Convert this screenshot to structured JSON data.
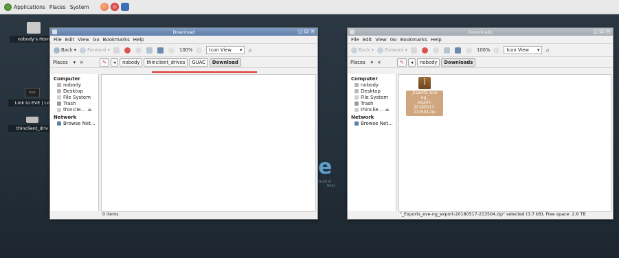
{
  "panel": {
    "menus": [
      "Applications",
      "Places",
      "System"
    ],
    "icons": [
      "applications-icon",
      "firefox-icon",
      "app-launcher-icon"
    ]
  },
  "desktop": {
    "icons": [
      {
        "label": "nobody's Hom",
        "icon": "home-folder-icon"
      },
      {
        "label": "Link to EVE | Lo",
        "icon": "eve-logo-icon"
      },
      {
        "label": "thinclient_driv",
        "icon": "drive-icon"
      }
    ],
    "watermark": "e",
    "watermark_sub_1": "ulated Vi",
    "watermark_sub_2": "Next"
  },
  "window_left": {
    "title": "Download",
    "menu": [
      "File",
      "Edit",
      "View",
      "Go",
      "Bookmarks",
      "Help"
    ],
    "toolbar": {
      "back": "Back",
      "forward": "Forward",
      "zoom": "100%",
      "view": "Icon View"
    },
    "places_label": "Places",
    "breadcrumbs": [
      "nobody",
      "thinclient_drives",
      "GUAC",
      "Download"
    ],
    "sidebar": {
      "computer_header": "Computer",
      "computer_items": [
        "nobody",
        "Desktop",
        "File System",
        "Trash",
        "thinclie..."
      ],
      "network_header": "Network",
      "network_items": [
        "Browse Net..."
      ]
    },
    "status": "0 items"
  },
  "window_right": {
    "title": "Downloads",
    "menu": [
      "File",
      "Edit",
      "View",
      "Go",
      "Bookmarks",
      "Help"
    ],
    "toolbar": {
      "back": "Back",
      "forward": "Forward",
      "zoom": "100%",
      "view": "Icon View"
    },
    "places_label": "Places",
    "breadcrumbs": [
      "nobody",
      "Downloads"
    ],
    "sidebar": {
      "computer_header": "Computer",
      "computer_items": [
        "nobody",
        "Desktop",
        "File System",
        "Trash",
        "thinclie..."
      ],
      "network_header": "Network",
      "network_items": [
        "Browse Net..."
      ]
    },
    "file": {
      "name_1": "_Exports_eve-ng_",
      "name_2": "export-20180517-",
      "name_3": "213504.zip"
    },
    "status": "\"_Exports_eve-ng_export-20180517-213504.zip\" selected (3.7 kB), Free space: 2.6 TB"
  },
  "colors": {
    "titlebar_active": "#6f8db6",
    "annotation": "#e0322b",
    "desktop": "#27343e"
  }
}
